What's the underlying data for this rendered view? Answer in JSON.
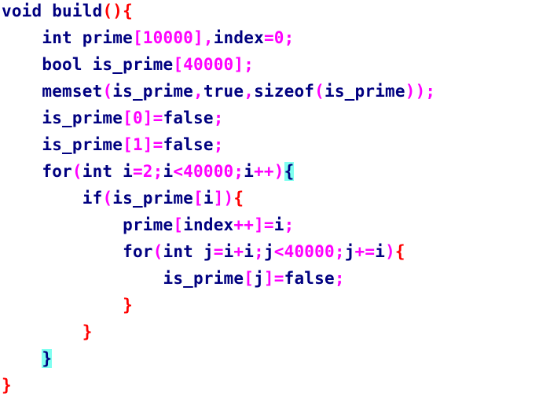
{
  "colors": {
    "background": "#ffffff",
    "text": "#000080",
    "keyword": "#000080",
    "operator": "#ff00ff",
    "punctuation": "#ff00ff",
    "brace": "#ff0000",
    "brace_highlight_bg": "#7ffff0"
  },
  "code": {
    "lines": [
      [
        {
          "t": "void build",
          "c": "#000080"
        },
        {
          "t": "(){",
          "c": "#ff0000"
        }
      ],
      [
        {
          "t": "    int prime",
          "c": "#000080"
        },
        {
          "t": "[10000],",
          "c": "#ff00ff"
        },
        {
          "t": "index",
          "c": "#000080"
        },
        {
          "t": "=0;",
          "c": "#ff00ff"
        }
      ],
      [
        {
          "t": "    bool is_prime",
          "c": "#000080"
        },
        {
          "t": "[40000];",
          "c": "#ff00ff"
        }
      ],
      [
        {
          "t": "    memset",
          "c": "#000080"
        },
        {
          "t": "(",
          "c": "#ff00ff"
        },
        {
          "t": "is_prime",
          "c": "#000080"
        },
        {
          "t": ",",
          "c": "#ff00ff"
        },
        {
          "t": "true",
          "c": "#000080"
        },
        {
          "t": ",",
          "c": "#ff00ff"
        },
        {
          "t": "sizeof",
          "c": "#000080"
        },
        {
          "t": "(",
          "c": "#ff00ff"
        },
        {
          "t": "is_prime",
          "c": "#000080"
        },
        {
          "t": "));",
          "c": "#ff00ff"
        }
      ],
      [
        {
          "t": "    is_prime",
          "c": "#000080"
        },
        {
          "t": "[0]=",
          "c": "#ff00ff"
        },
        {
          "t": "false",
          "c": "#000080"
        },
        {
          "t": ";",
          "c": "#ff00ff"
        }
      ],
      [
        {
          "t": "    is_prime",
          "c": "#000080"
        },
        {
          "t": "[1]=",
          "c": "#ff00ff"
        },
        {
          "t": "false",
          "c": "#000080"
        },
        {
          "t": ";",
          "c": "#ff00ff"
        }
      ],
      [
        {
          "t": "    for",
          "c": "#000080"
        },
        {
          "t": "(",
          "c": "#ff00ff"
        },
        {
          "t": "int i",
          "c": "#000080"
        },
        {
          "t": "=2;",
          "c": "#ff00ff"
        },
        {
          "t": "i",
          "c": "#000080"
        },
        {
          "t": "<40000;",
          "c": "#ff00ff"
        },
        {
          "t": "i",
          "c": "#000080"
        },
        {
          "t": "++)",
          "c": "#ff00ff"
        },
        {
          "t": "{",
          "c": "#000080",
          "hl": true
        }
      ],
      [
        {
          "t": "        if",
          "c": "#000080"
        },
        {
          "t": "(",
          "c": "#ff00ff"
        },
        {
          "t": "is_prime",
          "c": "#000080"
        },
        {
          "t": "[",
          "c": "#ff00ff"
        },
        {
          "t": "i",
          "c": "#000080"
        },
        {
          "t": "])",
          "c": "#ff00ff"
        },
        {
          "t": "{",
          "c": "#ff0000"
        }
      ],
      [
        {
          "t": "            prime",
          "c": "#000080"
        },
        {
          "t": "[",
          "c": "#ff00ff"
        },
        {
          "t": "index",
          "c": "#000080"
        },
        {
          "t": "++]=",
          "c": "#ff00ff"
        },
        {
          "t": "i",
          "c": "#000080"
        },
        {
          "t": ";",
          "c": "#ff00ff"
        }
      ],
      [
        {
          "t": "            for",
          "c": "#000080"
        },
        {
          "t": "(",
          "c": "#ff00ff"
        },
        {
          "t": "int j",
          "c": "#000080"
        },
        {
          "t": "=",
          "c": "#ff00ff"
        },
        {
          "t": "i",
          "c": "#000080"
        },
        {
          "t": "+",
          "c": "#ff00ff"
        },
        {
          "t": "i",
          "c": "#000080"
        },
        {
          "t": ";",
          "c": "#ff00ff"
        },
        {
          "t": "j",
          "c": "#000080"
        },
        {
          "t": "<40000;",
          "c": "#ff00ff"
        },
        {
          "t": "j",
          "c": "#000080"
        },
        {
          "t": "+=",
          "c": "#ff00ff"
        },
        {
          "t": "i",
          "c": "#000080"
        },
        {
          "t": ")",
          "c": "#ff00ff"
        },
        {
          "t": "{",
          "c": "#ff0000"
        }
      ],
      [
        {
          "t": "                is_prime",
          "c": "#000080"
        },
        {
          "t": "[",
          "c": "#ff00ff"
        },
        {
          "t": "j",
          "c": "#000080"
        },
        {
          "t": "]=",
          "c": "#ff00ff"
        },
        {
          "t": "false",
          "c": "#000080"
        },
        {
          "t": ";",
          "c": "#ff00ff"
        }
      ],
      [
        {
          "t": "            }",
          "c": "#ff0000"
        }
      ],
      [
        {
          "t": "        }",
          "c": "#ff0000"
        }
      ],
      [
        {
          "t": "    ",
          "c": "#000080"
        },
        {
          "t": "}",
          "c": "#000080",
          "hl": true
        }
      ],
      [
        {
          "t": "}",
          "c": "#ff0000"
        }
      ]
    ]
  }
}
